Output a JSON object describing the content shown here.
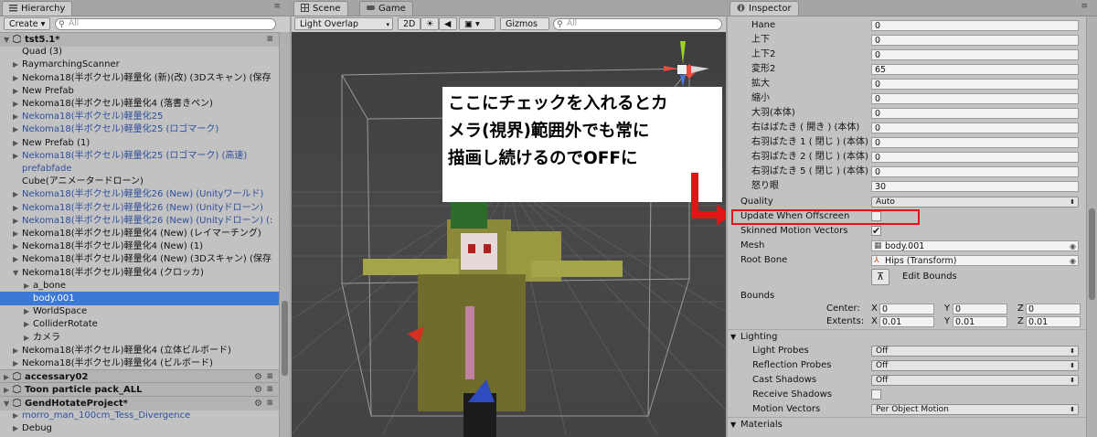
{
  "hierarchy": {
    "tab": "Hierarchy",
    "create": "Create",
    "search_placeholder": "All",
    "rows": [
      {
        "label": "tst5.1*",
        "type": "scene",
        "arrow": "▼"
      },
      {
        "label": "Quad (3)",
        "type": "normal",
        "arrow": ""
      },
      {
        "label": "RaymarchingScanner",
        "type": "normal",
        "arrow": "▶"
      },
      {
        "label": "Nekoma18(半ボクセル)軽量化 (新)(改) (3Dスキャン) (保存",
        "type": "normal",
        "arrow": "▶"
      },
      {
        "label": "New Prefab",
        "type": "normal",
        "arrow": "▶"
      },
      {
        "label": "Nekoma18(半ボクセル)軽量化4 (落書きペン)",
        "type": "normal",
        "arrow": "▶"
      },
      {
        "label": "Nekoma18(半ボクセル)軽量化25",
        "type": "prefab",
        "arrow": "▶"
      },
      {
        "label": "Nekoma18(半ボクセル)軽量化25 (ロゴマーク)",
        "type": "prefab",
        "arrow": "▶"
      },
      {
        "label": "New Prefab (1)",
        "type": "normal",
        "arrow": "▶"
      },
      {
        "label": "Nekoma18(半ボクセル)軽量化25 (ロゴマーク) (高速)",
        "type": "prefab",
        "arrow": "▶"
      },
      {
        "label": "prefabfade",
        "type": "prefab",
        "arrow": ""
      },
      {
        "label": "Cube(アニメータードローン)",
        "type": "normal",
        "arrow": ""
      },
      {
        "label": "Nekoma18(半ボクセル)軽量化26 (New) (Unityワールド)",
        "type": "prefab",
        "arrow": "▶"
      },
      {
        "label": "Nekoma18(半ボクセル)軽量化26 (New) (Unityドローン)",
        "type": "prefab",
        "arrow": "▶"
      },
      {
        "label": "Nekoma18(半ボクセル)軽量化26 (New) (Unityドローン) (:",
        "type": "prefab",
        "arrow": "▶"
      },
      {
        "label": "Nekoma18(半ボクセル)軽量化4 (New) (レイマーチング)",
        "type": "normal",
        "arrow": "▶"
      },
      {
        "label": "Nekoma18(半ボクセル)軽量化4 (New) (1)",
        "type": "normal",
        "arrow": "▶"
      },
      {
        "label": "Nekoma18(半ボクセル)軽量化4 (New) (3Dスキャン) (保存",
        "type": "normal",
        "arrow": "▶"
      },
      {
        "label": "Nekoma18(半ボクセル)軽量化4 (クロッカ)",
        "type": "normal",
        "arrow": "▼"
      },
      {
        "label": "a_bone",
        "type": "child",
        "arrow": "▶"
      },
      {
        "label": "body.001",
        "type": "selected",
        "arrow": ""
      },
      {
        "label": "WorldSpace",
        "type": "child",
        "arrow": "▶"
      },
      {
        "label": "ColliderRotate",
        "type": "child",
        "arrow": "▶"
      },
      {
        "label": "カメラ",
        "type": "child",
        "arrow": "▶"
      },
      {
        "label": "Nekoma18(半ボクセル)軽量化4 (立体ビルボード)",
        "type": "normal",
        "arrow": "▶"
      },
      {
        "label": "Nekoma18(半ボクセル)軽量化4 (ビルボード)",
        "type": "normal",
        "arrow": "▶"
      },
      {
        "label": "accessary02",
        "type": "scene",
        "arrow": "▶"
      },
      {
        "label": "Toon particle pack_ALL",
        "type": "scene",
        "arrow": "▶"
      },
      {
        "label": "GendHotateProject*",
        "type": "scene",
        "arrow": "▼"
      },
      {
        "label": "morro_man_100cm_Tess_Divergence",
        "type": "prefab",
        "arrow": "▶"
      },
      {
        "label": "Debug",
        "type": "normal",
        "arrow": "▶"
      }
    ]
  },
  "scene": {
    "tabs": [
      "Scene",
      "Game"
    ],
    "shading_mode": "Light Overlap",
    "mode_2d": "2D",
    "gizmos": "Gizmos",
    "search_placeholder": "All",
    "annotation": [
      "ここにチェックを入れるとカ",
      "メラ(視界)範囲外でも常に",
      "描画し続けるのでOFFに"
    ]
  },
  "inspector": {
    "tab": "Inspector",
    "blendshapes": [
      {
        "label": "Hane",
        "value": "0"
      },
      {
        "label": "上下",
        "value": "0"
      },
      {
        "label": "上下2",
        "value": "0"
      },
      {
        "label": "変形2",
        "value": "65"
      },
      {
        "label": "拡大",
        "value": "0"
      },
      {
        "label": "縮小",
        "value": "0"
      },
      {
        "label": "大羽(本体)",
        "value": "0"
      },
      {
        "label": "右はばたき ( 開き ) (本体)",
        "value": "0"
      },
      {
        "label": "右羽ばたき 1 ( 閉じ ) (本体)",
        "value": "0"
      },
      {
        "label": "右羽ばたき 2 ( 閉じ ) (本体)",
        "value": "0"
      },
      {
        "label": "右羽ばたき 5 ( 閉じ ) (本体)",
        "value": "0"
      },
      {
        "label": "怒り眼",
        "value": "30"
      }
    ],
    "quality": {
      "label": "Quality",
      "value": "Auto"
    },
    "update_offscreen": {
      "label": "Update When Offscreen",
      "checked": false
    },
    "skinned_motion": {
      "label": "Skinned Motion Vectors",
      "checked": true
    },
    "mesh": {
      "label": "Mesh",
      "value": "body.001"
    },
    "root_bone": {
      "label": "Root Bone",
      "value": "Hips (Transform)"
    },
    "edit_bounds": "Edit Bounds",
    "bounds": {
      "label": "Bounds",
      "center_label": "Center:",
      "extents_label": "Extents:",
      "center": {
        "x": "0",
        "y": "0",
        "z": "0"
      },
      "extents": {
        "x": "0.01",
        "y": "0.01",
        "z": "0.01"
      }
    },
    "lighting": {
      "label": "Lighting",
      "light_probes": {
        "label": "Light Probes",
        "value": "Off"
      },
      "reflection_probes": {
        "label": "Reflection Probes",
        "value": "Off"
      },
      "cast_shadows": {
        "label": "Cast Shadows",
        "value": "Off"
      },
      "receive_shadows": {
        "label": "Receive Shadows",
        "checked": false
      },
      "motion_vectors": {
        "label": "Motion Vectors",
        "value": "Per Object Motion"
      }
    },
    "materials_label": "Materials"
  },
  "colors": {
    "selection": "#3b79d8",
    "highlight": "#e01515",
    "prefab_text": "#2f4f9a"
  }
}
